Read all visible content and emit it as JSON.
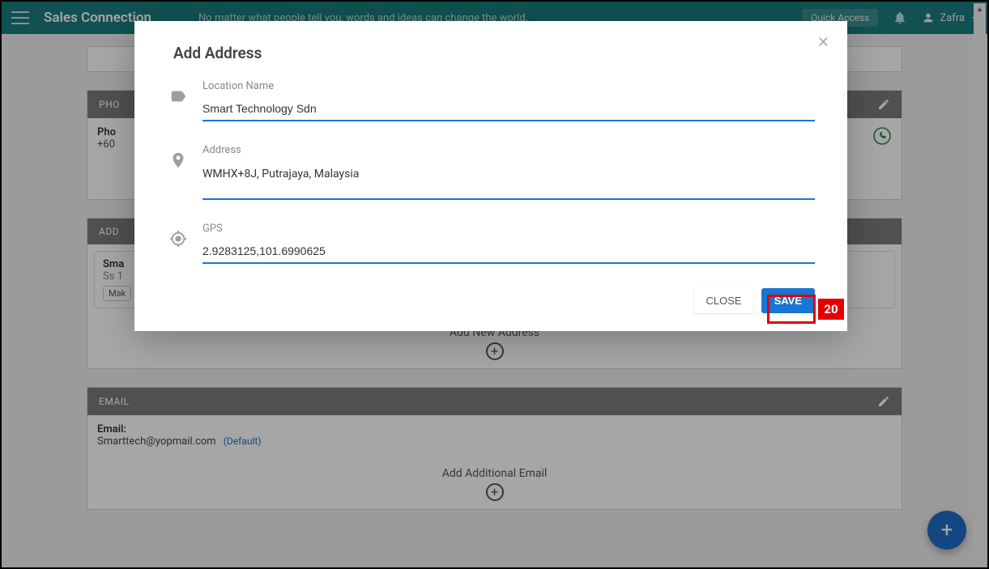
{
  "header": {
    "app_title": "Sales Connection",
    "tagline": "No matter what people tell you, words and ideas can change the world.",
    "quick_access": "Quick Access",
    "user_name": "Zafra"
  },
  "background": {
    "phone_section": {
      "header": "PHO",
      "label": "Pho",
      "value": "+60"
    },
    "address_section": {
      "header": "ADD",
      "name": "Sma",
      "line": "Ss 1",
      "make_default": "Mak",
      "add_new_text": "Add New Address"
    },
    "email_section": {
      "header": "EMAIL",
      "label": "Email:",
      "value": "Smarttech@yopmail.com",
      "default_badge": "(Default)",
      "add_new_text": "Add Additional Email"
    }
  },
  "modal": {
    "title": "Add Address",
    "fields": {
      "location": {
        "label": "Location Name",
        "value": "Smart Technology Sdn"
      },
      "address": {
        "label": "Address",
        "value": "WMHX+8J, Putrajaya, Malaysia"
      },
      "gps": {
        "label": "GPS",
        "value": "2.9283125,101.6990625"
      }
    },
    "buttons": {
      "close": "CLOSE",
      "save": "SAVE"
    }
  },
  "annotation": {
    "callout": "20"
  }
}
